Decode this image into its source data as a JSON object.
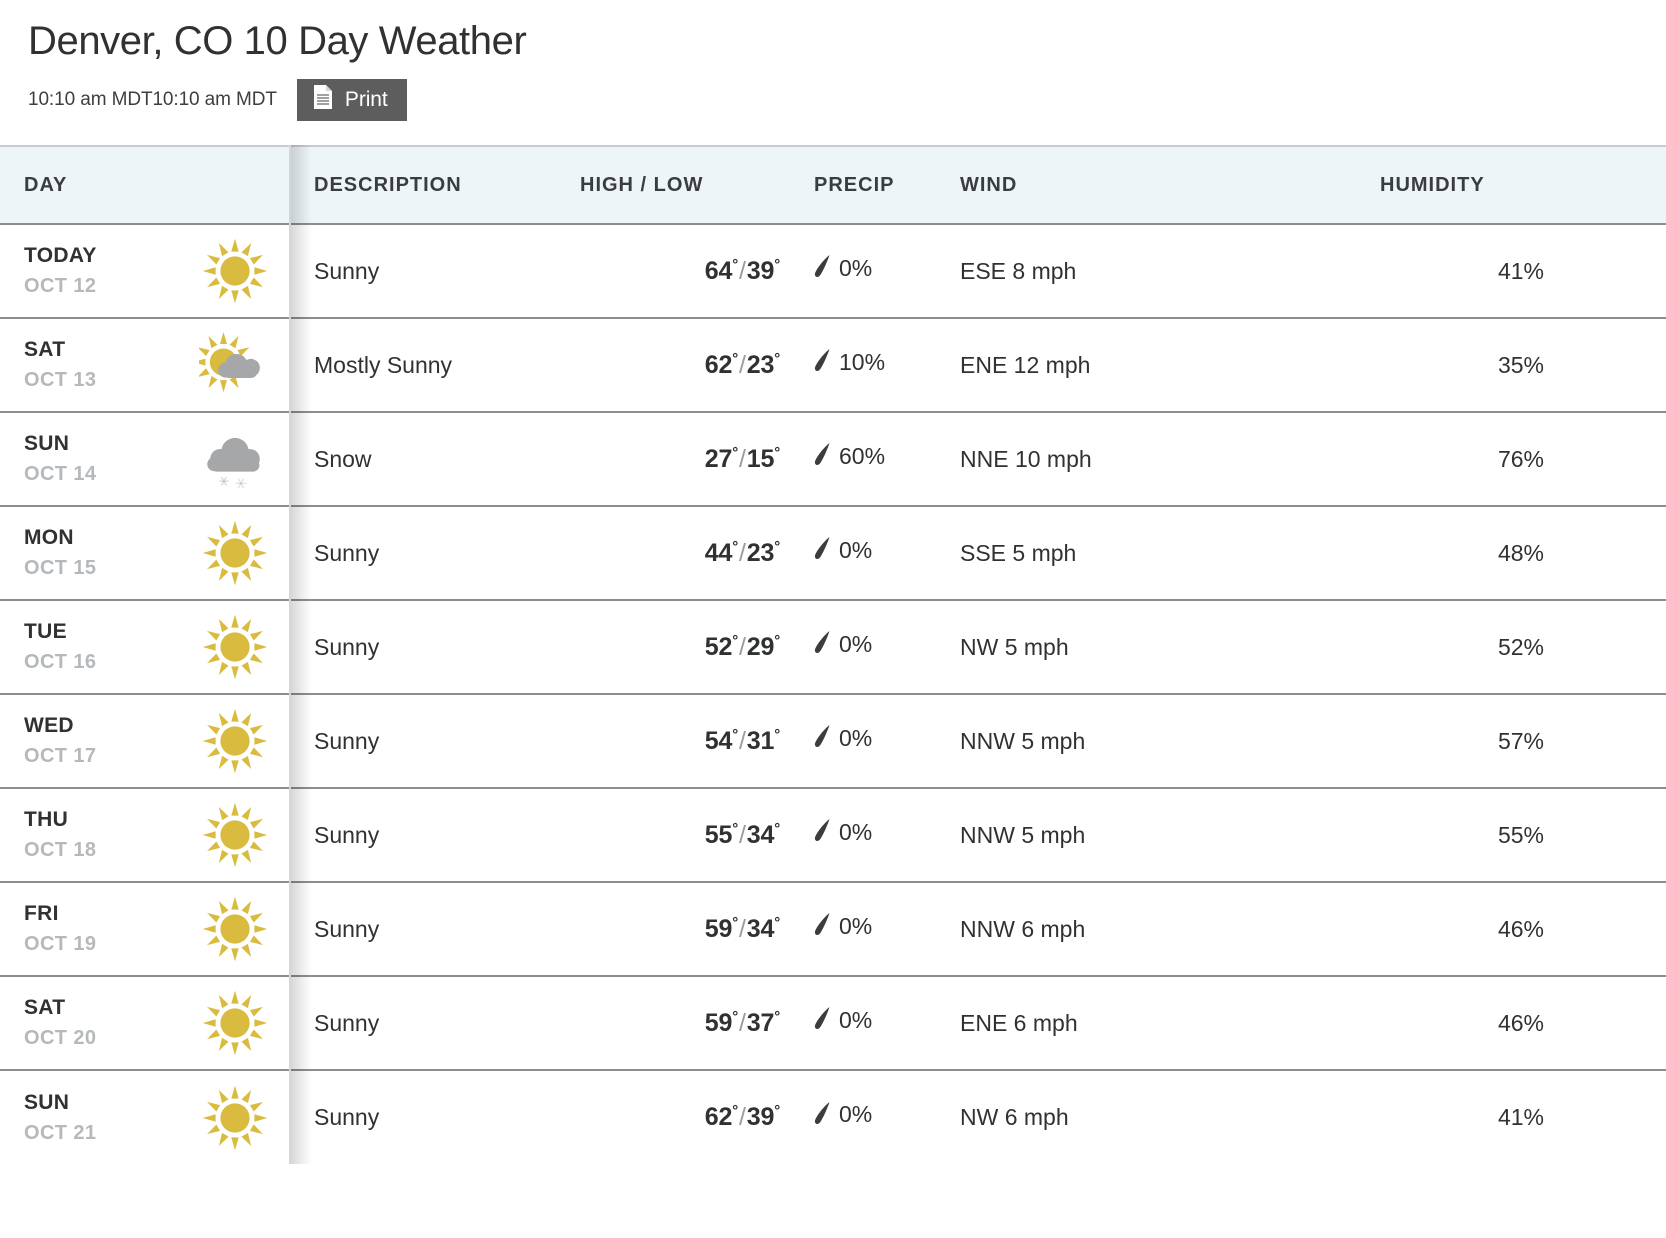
{
  "header": {
    "title": "Denver, CO 10 Day Weather",
    "timestamp": "10:10 am MDT10:10 am MDT",
    "print_label": "Print",
    "print_icon": "document-icon"
  },
  "table": {
    "columns": [
      {
        "key": "day",
        "label": "DAY"
      },
      {
        "key": "description",
        "label": "DESCRIPTION"
      },
      {
        "key": "high_low",
        "label": "HIGH / LOW"
      },
      {
        "key": "precip",
        "label": "PRECIP"
      },
      {
        "key": "wind",
        "label": "WIND"
      },
      {
        "key": "humidity",
        "label": "HUMIDITY"
      }
    ],
    "rows": [
      {
        "day": "TODAY",
        "date": "OCT 12",
        "icon": "sunny-icon",
        "description": "Sunny",
        "high": "64",
        "low": "39",
        "precip": "0%",
        "precip_icon": "raindrop-icon",
        "wind": "ESE 8 mph",
        "humidity": "41%"
      },
      {
        "day": "SAT",
        "date": "OCT 13",
        "icon": "partly-cloudy-icon",
        "description": "Mostly Sunny",
        "high": "62",
        "low": "23",
        "precip": "10%",
        "precip_icon": "raindrop-icon",
        "wind": "ENE 12 mph",
        "humidity": "35%"
      },
      {
        "day": "SUN",
        "date": "OCT 14",
        "icon": "snow-cloud-icon",
        "description": "Snow",
        "high": "27",
        "low": "15",
        "precip": "60%",
        "precip_icon": "raindrop-icon",
        "wind": "NNE 10 mph",
        "humidity": "76%"
      },
      {
        "day": "MON",
        "date": "OCT 15",
        "icon": "sunny-icon",
        "description": "Sunny",
        "high": "44",
        "low": "23",
        "precip": "0%",
        "precip_icon": "raindrop-icon",
        "wind": "SSE 5 mph",
        "humidity": "48%"
      },
      {
        "day": "TUE",
        "date": "OCT 16",
        "icon": "sunny-icon",
        "description": "Sunny",
        "high": "52",
        "low": "29",
        "precip": "0%",
        "precip_icon": "raindrop-icon",
        "wind": "NW 5 mph",
        "humidity": "52%"
      },
      {
        "day": "WED",
        "date": "OCT 17",
        "icon": "sunny-icon",
        "description": "Sunny",
        "high": "54",
        "low": "31",
        "precip": "0%",
        "precip_icon": "raindrop-icon",
        "wind": "NNW 5 mph",
        "humidity": "57%"
      },
      {
        "day": "THU",
        "date": "OCT 18",
        "icon": "sunny-icon",
        "description": "Sunny",
        "high": "55",
        "low": "34",
        "precip": "0%",
        "precip_icon": "raindrop-icon",
        "wind": "NNW 5 mph",
        "humidity": "55%"
      },
      {
        "day": "FRI",
        "date": "OCT 19",
        "icon": "sunny-icon",
        "description": "Sunny",
        "high": "59",
        "low": "34",
        "precip": "0%",
        "precip_icon": "raindrop-icon",
        "wind": "NNW 6 mph",
        "humidity": "46%"
      },
      {
        "day": "SAT",
        "date": "OCT 20",
        "icon": "sunny-icon",
        "description": "Sunny",
        "high": "59",
        "low": "37",
        "precip": "0%",
        "precip_icon": "raindrop-icon",
        "wind": "ENE 6 mph",
        "humidity": "46%"
      },
      {
        "day": "SUN",
        "date": "OCT 21",
        "icon": "sunny-icon",
        "description": "Sunny",
        "high": "62",
        "low": "39",
        "precip": "0%",
        "precip_icon": "raindrop-icon",
        "wind": "NW 6 mph",
        "humidity": "41%"
      }
    ]
  },
  "colors": {
    "sun_yellow": "#d9bc3f",
    "cloud_gray": "#a5a7a8",
    "header_bg": "#eef5f8",
    "print_bg": "#5d5d5d",
    "text": "#2f3133",
    "muted_text": "#b6b9bb"
  }
}
